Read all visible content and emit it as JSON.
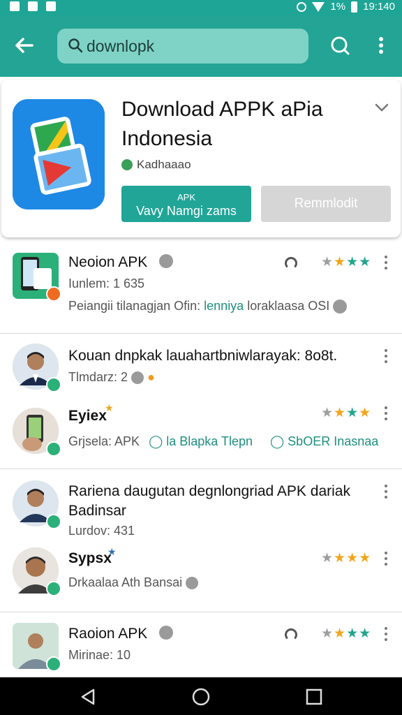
{
  "status_bar": {
    "time": "19:140",
    "battery": "1%"
  },
  "search": {
    "value": "downlopk"
  },
  "featured": {
    "title": "Download APPK aPia Indonesia",
    "developer": "Kadhaaao",
    "install_line1": "APK",
    "install_line2": "Vavy Namgi zams",
    "secondary_button": "Remmlodit"
  },
  "items": [
    {
      "name": "Neoion APK",
      "sub": "Iunlem: 1 635",
      "meta_a": "Peiangii tilanagjan",
      "meta_b": "Ofin:",
      "meta_c": "lenniya",
      "meta_d": "loraklaasa OSI",
      "rating": "3.5"
    },
    {
      "name": "Kouan dnpkak lauahartbniwlarayak: 8o8t.",
      "sub": "Tlmdarz: 2"
    },
    {
      "name": "Eyiex",
      "meta_a": "Grjsela: APK",
      "meta_b": "la Blapka Tlepn",
      "meta_c": "SbOER Inasnaa",
      "rating": "3.5"
    },
    {
      "name": "Rariena daugutan degnlongriad APK dariak Badinsar",
      "sub": "Lurdov: 431"
    },
    {
      "name": "Sypsx",
      "meta_a": "Drkaalaa Ath Bansai",
      "rating": "3.5"
    },
    {
      "name": "Raoion APK",
      "sub": "Mirinae: 10",
      "rating": "3.5"
    }
  ],
  "colors": {
    "accent": "#23a494",
    "star": "#f2a51b"
  }
}
